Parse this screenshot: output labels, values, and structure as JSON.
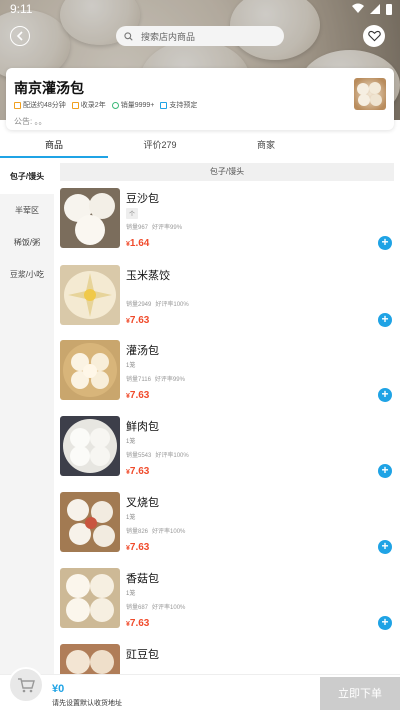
{
  "status_bar": {
    "time": "9:11"
  },
  "header": {
    "search_placeholder": "搜索店内商品"
  },
  "store": {
    "name": "南京灌汤包",
    "tags": [
      {
        "label": "配送约48分钟",
        "icon": "delivery-icon",
        "color": "#f0a020"
      },
      {
        "label": "收录2年",
        "icon": "badge-icon",
        "color": "#f0a020"
      },
      {
        "label": "销量9999+",
        "icon": "sales-icon",
        "color": "#3cb878"
      },
      {
        "label": "支持预定",
        "icon": "reserve-icon",
        "color": "#1fa3e5"
      }
    ],
    "notice": "公告: 。。"
  },
  "tabs": [
    {
      "label": "商品",
      "active": true
    },
    {
      "label": "评价279",
      "active": false
    },
    {
      "label": "商家",
      "active": false
    }
  ],
  "sidebar": [
    {
      "label": "包子/馒头",
      "active": true
    },
    {
      "label": "半荤区",
      "active": false
    },
    {
      "label": "稀饭/粥",
      "active": false
    },
    {
      "label": "豆浆/小吃",
      "active": false
    }
  ],
  "category_header": "包子/馒头",
  "products": [
    {
      "name": "豆沙包",
      "unit": "个",
      "sales": "销量967",
      "rating": "好评率99%",
      "price_symbol": "¥",
      "price": "1.64"
    },
    {
      "name": "玉米蒸饺",
      "unit": "",
      "sales": "销量2949",
      "rating": "好评率100%",
      "price_symbol": "¥",
      "price": "7.63"
    },
    {
      "name": "灌汤包",
      "unit": "1笼",
      "sales": "销量7116",
      "rating": "好评率99%",
      "price_symbol": "¥",
      "price": "7.63"
    },
    {
      "name": "鲜肉包",
      "unit": "1笼",
      "sales": "销量5543",
      "rating": "好评率100%",
      "price_symbol": "¥",
      "price": "7.63"
    },
    {
      "name": "叉烧包",
      "unit": "1笼",
      "sales": "销量826",
      "rating": "好评率100%",
      "price_symbol": "¥",
      "price": "7.63"
    },
    {
      "name": "香菇包",
      "unit": "1笼",
      "sales": "销量687",
      "rating": "好评率100%",
      "price_symbol": "¥",
      "price": "7.63"
    },
    {
      "name": "豇豆包",
      "unit": "",
      "sales": "",
      "rating": "",
      "price_symbol": "",
      "price": ""
    }
  ],
  "cart": {
    "total": "¥0",
    "address_hint": "请先设置默认收货地址",
    "order_label": "立即下单"
  },
  "colors": {
    "accent": "#1fa3e5",
    "price": "#f04b2c"
  }
}
